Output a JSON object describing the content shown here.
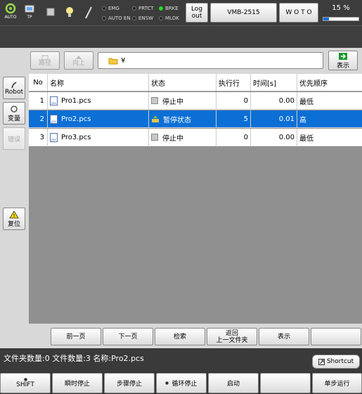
{
  "header": {
    "auto_label": "AUTO",
    "tp_label": "TP",
    "indicators": {
      "emg": "EMG",
      "autoen": "AUTO EN",
      "prtct": "PRTCT",
      "ensw": "ENSW",
      "brke": "BRKE",
      "mlok": "MLOK"
    },
    "logout_label": "Log out",
    "robot_model": "VMB-2515",
    "user": "W O T O",
    "speed_percent": "15 %",
    "speed_fraction": 0.15,
    "accent": "#1a6fd4",
    "brake_color": "#22dd22"
  },
  "toolbar": {
    "path_button": "路径",
    "up_button": "向上",
    "path_value": "¥",
    "display_button": "表示"
  },
  "sidebar": {
    "robot": "Robot",
    "variable": "变量",
    "error": "错误",
    "reset": "复位"
  },
  "table": {
    "columns": [
      "No",
      "名称",
      "状态",
      "执行行",
      "时间[s]",
      "优先顺序"
    ],
    "rows": [
      {
        "no": "1",
        "name": "Pro1.pcs",
        "state": "停止中",
        "line": "0",
        "time": "0.00",
        "priority": "最低"
      },
      {
        "no": "2",
        "name": "Pro2.pcs",
        "state": "暂停状态",
        "line": "5",
        "time": "0.01",
        "priority": "高"
      },
      {
        "no": "3",
        "name": "Pro3.pcs",
        "state": "停止中",
        "line": "0",
        "time": "0.00",
        "priority": "最低"
      }
    ],
    "selected_color": "#0b6fd6"
  },
  "functions": {
    "prev_page": "前一页",
    "next_page": "下一页",
    "search": "检索",
    "return_folder": "返回\n上一文件夹",
    "display": "表示"
  },
  "status": {
    "text": "文件夹数量:0  文件数量:3  名称:Pro2.pcs",
    "shortcut": "Shortcut"
  },
  "bottom": {
    "shift": "SHIFT",
    "instant_stop": "瞬时停止",
    "step_stop": "步骤停止",
    "cycle_stop": "循环停止",
    "start": "启动",
    "single_step": "单步运行"
  }
}
